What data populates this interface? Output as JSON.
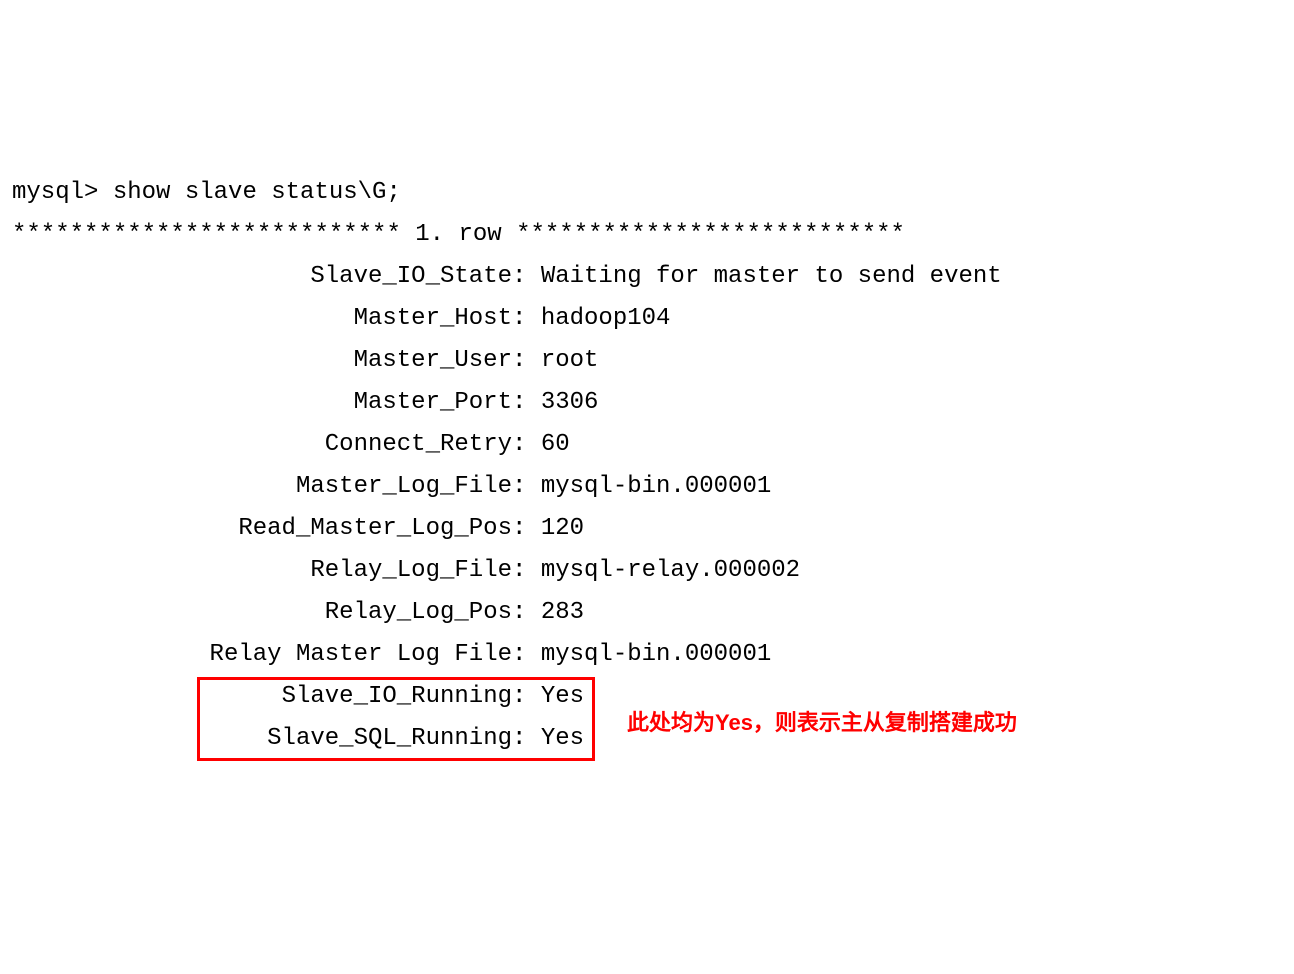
{
  "prompt": "mysql> show slave status\\G;",
  "row_header": "*************************** 1. row ***************************",
  "fields": [
    {
      "label": "Slave_IO_State",
      "value": "Waiting for master to send event"
    },
    {
      "label": "Master_Host",
      "value": "hadoop104"
    },
    {
      "label": "Master_User",
      "value": "root"
    },
    {
      "label": "Master_Port",
      "value": "3306"
    },
    {
      "label": "Connect_Retry",
      "value": "60"
    },
    {
      "label": "Master_Log_File",
      "value": "mysql-bin.000001"
    },
    {
      "label": "Read_Master_Log_Pos",
      "value": "120"
    },
    {
      "label": "Relay_Log_File",
      "value": "mysql-relay.000002"
    },
    {
      "label": "Relay_Log_Pos",
      "value": "283"
    },
    {
      "label": "Relay_Master_Log_File",
      "value": "mysql-bin.000001"
    },
    {
      "label": "Slave_IO_Running",
      "value": "Yes"
    },
    {
      "label": "Slave_SQL_Running",
      "value": "Yes"
    }
  ],
  "annotation": "此处均为Yes，则表示主从复制搭建成功",
  "highlight_start_index": 10,
  "highlight_end_index": 11,
  "underscore_labels": {
    "9": "Relay Master Log File"
  }
}
